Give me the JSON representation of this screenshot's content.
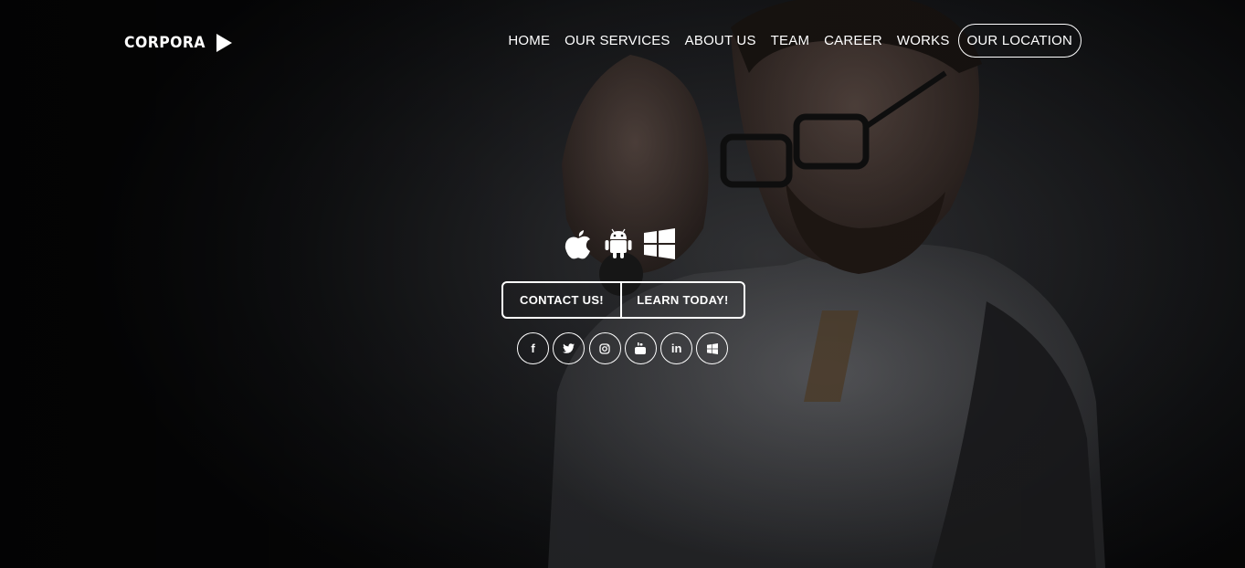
{
  "brand": {
    "name": "CORPORA",
    "logo_icon": "play-triangle-icon"
  },
  "nav": {
    "items": [
      {
        "label": "HOME"
      },
      {
        "label": "OUR SERVICES"
      },
      {
        "label": "ABOUT US"
      },
      {
        "label": "TEAM"
      },
      {
        "label": "CAREER"
      },
      {
        "label": "WORKS"
      }
    ],
    "highlight_label": "OUR LOCATION"
  },
  "platforms": [
    "apple-icon",
    "android-icon",
    "windows-icon"
  ],
  "cta": {
    "primary_label": "CONTACT US!",
    "secondary_label": "LEARN TODAY!"
  },
  "social": {
    "icons": [
      "facebook-icon",
      "twitter-icon",
      "instagram-icon",
      "youtube-icon",
      "linkedin-icon",
      "windows-icon"
    ],
    "glyphs": {
      "facebook": "f",
      "linkedin": "in"
    }
  },
  "colors": {
    "text": "#ffffff",
    "background": "#0b0b0c"
  }
}
